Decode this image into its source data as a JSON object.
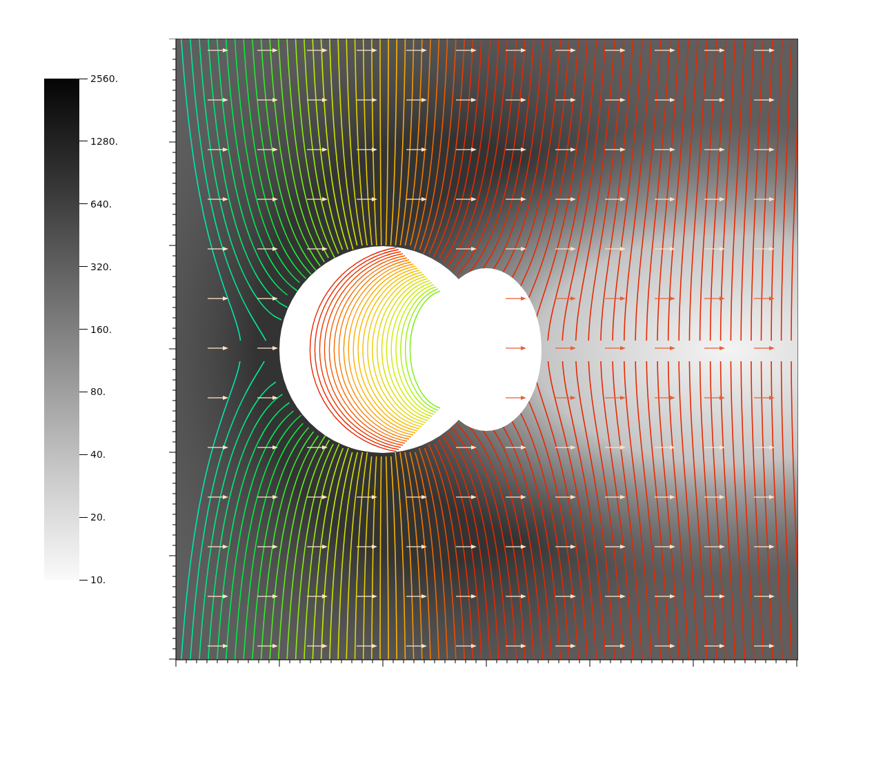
{
  "legend": {
    "labels": [
      "2560.",
      "1280.",
      "640.",
      "320.",
      "160.",
      "80.",
      "40.",
      "20.",
      "10."
    ]
  }
}
